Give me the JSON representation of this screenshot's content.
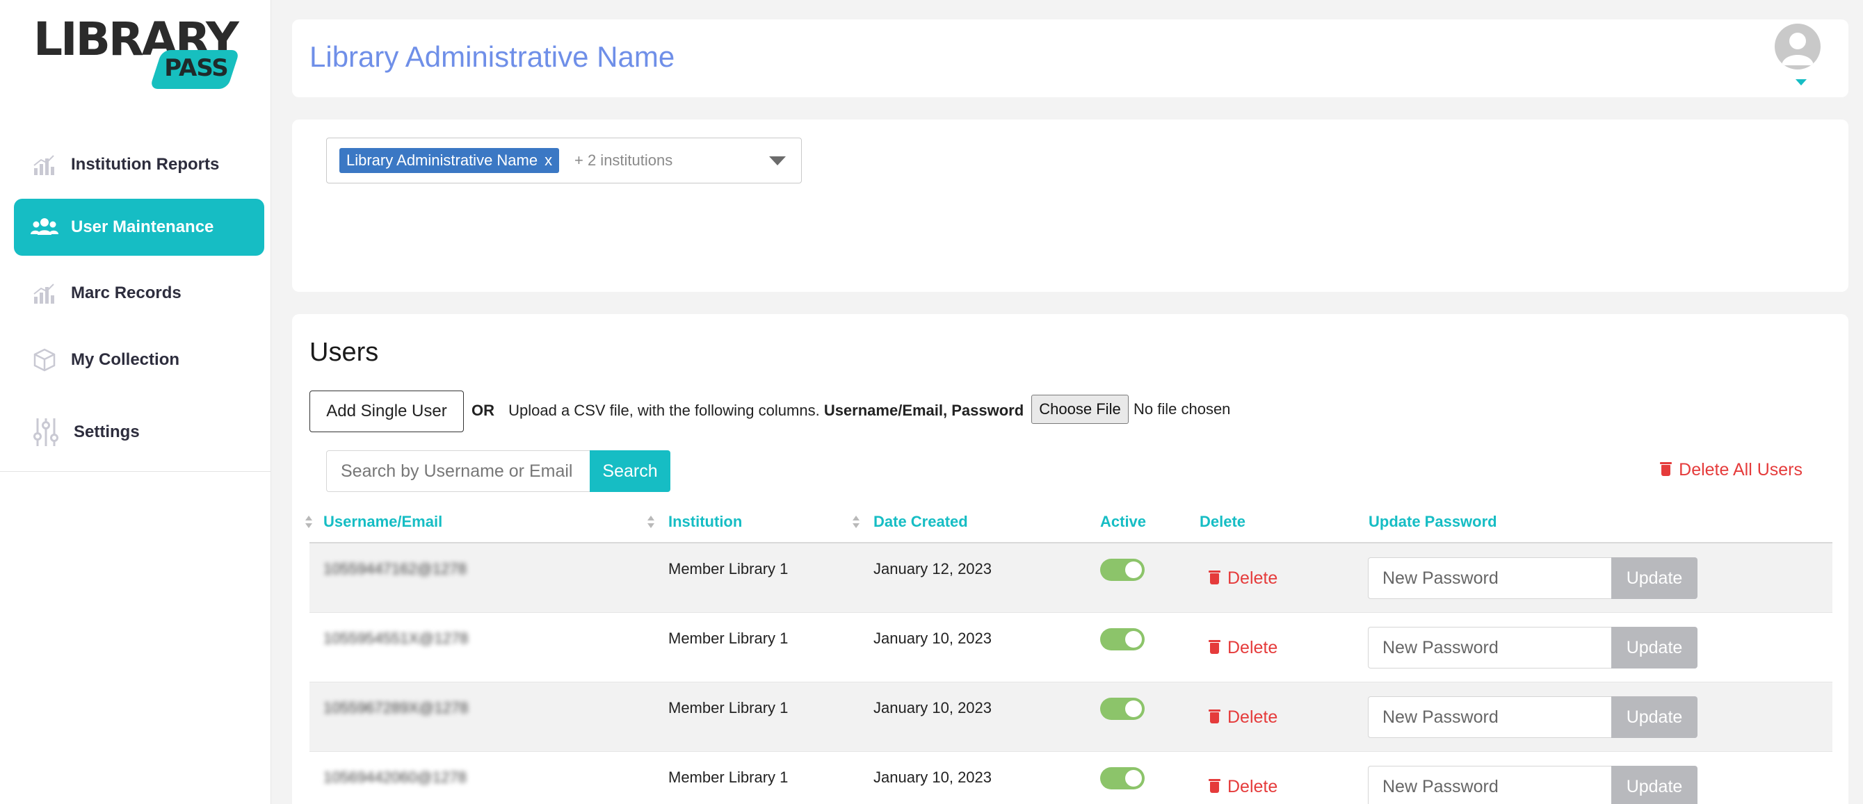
{
  "brand": {
    "logo_word": "LIBRARY",
    "logo_badge": "PASS",
    "accent": "#16bdc4"
  },
  "sidebar": {
    "items": [
      {
        "label": "Institution Reports",
        "icon": "bar-chart-icon",
        "active": false
      },
      {
        "label": "User Maintenance",
        "icon": "users-icon",
        "active": true
      },
      {
        "label": "Marc Records",
        "icon": "bar-chart-icon",
        "active": false
      },
      {
        "label": "My Collection",
        "icon": "cube-icon",
        "active": false
      },
      {
        "label": "Settings",
        "icon": "sliders-icon",
        "active": false
      }
    ]
  },
  "header": {
    "title": "Library Administrative Name",
    "avatar_icon": "user-avatar-icon"
  },
  "institution_filter": {
    "selected_tag": "Library Administrative Name",
    "remove_label": "x",
    "more_label": "+ 2 institutions"
  },
  "users": {
    "title": "Users",
    "add_single_label": "Add Single User",
    "or_label": "OR",
    "upload_text": "Upload a CSV file, with the following columns.",
    "upload_columns": "Username/Email, Password",
    "choose_file_label": "Choose File",
    "no_file_label": "No file chosen",
    "search_placeholder": "Search by Username or Email",
    "search_label": "Search",
    "delete_all_label": "Delete All Users",
    "columns": {
      "username": "Username/Email",
      "institution": "Institution",
      "date_created": "Date Created",
      "active": "Active",
      "delete": "Delete",
      "update_password": "Update Password"
    },
    "rows": [
      {
        "username": "10559447162@1278",
        "institution": "Member Library 1",
        "date_created": "January 12, 2023",
        "active": true,
        "delete_label": "Delete",
        "password_placeholder": "New Password",
        "update_label": "Update"
      },
      {
        "username": "1055954551X@1278",
        "institution": "Member Library 1",
        "date_created": "January 10, 2023",
        "active": true,
        "delete_label": "Delete",
        "password_placeholder": "New Password",
        "update_label": "Update"
      },
      {
        "username": "1055967289X@1278",
        "institution": "Member Library 1",
        "date_created": "January 10, 2023",
        "active": true,
        "delete_label": "Delete",
        "password_placeholder": "New Password",
        "update_label": "Update"
      },
      {
        "username": "10569442060@1278",
        "institution": "Member Library 1",
        "date_created": "January 10, 2023",
        "active": true,
        "delete_label": "Delete",
        "password_placeholder": "New Password",
        "update_label": "Update"
      }
    ]
  }
}
